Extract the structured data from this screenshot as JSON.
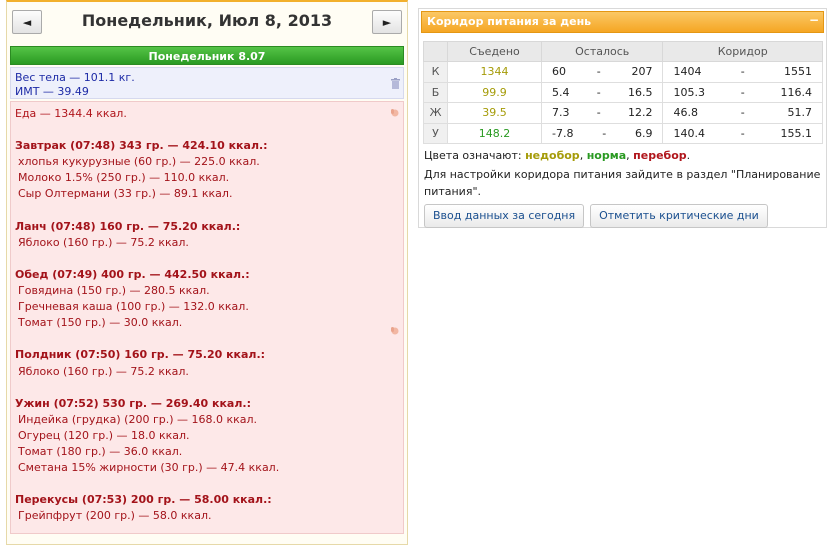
{
  "header": {
    "prev_label": "◄",
    "next_label": "►",
    "date_title": "Понедельник, Июл 8, 2013"
  },
  "day_bar": "Понедельник 8.07",
  "body": {
    "weight": "Вес тела — 101.1 кг.",
    "bmi": "ИМТ — 39.49"
  },
  "food": {
    "total": "Еда — 1344.4 ккал.",
    "meals": [
      {
        "title": "Завтрак (07:48) 343 гр. — 424.10 ккал.:",
        "items": [
          "хлопья кукурузные (60 гр.) — 225.0 ккал.",
          "Молоко 1.5% (250 гр.) — 110.0 ккал.",
          "Сыр Олтермани (33 гр.) — 89.1 ккал."
        ]
      },
      {
        "title": "Ланч (07:48) 160 гр. — 75.20 ккал.:",
        "items": [
          "Яблоко (160 гр.) — 75.2 ккал."
        ]
      },
      {
        "title": "Обед (07:49) 400 гр. — 442.50 ккал.:",
        "items": [
          "Говядина (150 гр.) — 280.5 ккал.",
          "Гречневая каша (100 гр.) — 132.0 ккал.",
          "Томат (150 гр.) — 30.0 ккал."
        ]
      },
      {
        "title": "Полдник (07:50) 160 гр. — 75.20 ккал.:",
        "items": [
          "Яблоко (160 гр.) — 75.2 ккал."
        ]
      },
      {
        "title": "Ужин (07:52) 530 гр. — 269.40 ккал.:",
        "items": [
          "Индейка (грудка) (200 гр.) — 168.0 ккал.",
          "Огурец (120 гр.) — 18.0 ккал.",
          "Томат (180 гр.) — 36.0 ккал.",
          "Сметана 15% жирности (30 гр.) — 47.4 ккал."
        ]
      },
      {
        "title": "Перекусы (07:53) 200 гр. — 58.00 ккал.:",
        "items": [
          "Грейпфрут (200 гр.) — 58.0 ккал."
        ]
      }
    ]
  },
  "corridor": {
    "title": "Коридор питания за день",
    "collapse_label": "−",
    "headers": {
      "eaten": "Съедено",
      "left": "Осталось",
      "corridor": "Коридор"
    },
    "dash": "-",
    "rows": [
      {
        "letter": "К",
        "eaten": "1344",
        "status": "under",
        "left_min": "60",
        "left_max": "207",
        "corr_min": "1404",
        "corr_max": "1551"
      },
      {
        "letter": "Б",
        "eaten": "99.9",
        "status": "under",
        "left_min": "5.4",
        "left_max": "16.5",
        "corr_min": "105.3",
        "corr_max": "116.4"
      },
      {
        "letter": "Ж",
        "eaten": "39.5",
        "status": "under",
        "left_min": "7.3",
        "left_max": "12.2",
        "corr_min": "46.8",
        "corr_max": "51.7"
      },
      {
        "letter": "У",
        "eaten": "148.2",
        "status": "norm",
        "left_min": "-7.8",
        "left_max": "6.9",
        "corr_min": "140.4",
        "corr_max": "155.1"
      }
    ],
    "legend": {
      "prefix": "Цвета означают: ",
      "under": "недобор",
      "sep1": ", ",
      "norm": "норма",
      "sep2": ", ",
      "over": "перебор",
      "end": "."
    },
    "hint": "Для настройки коридора питания зайдите в раздел \"Планирование питания\".",
    "btn_enter": "Ввод данных за сегодня",
    "btn_critical": "Отметить критические дни"
  },
  "colors": {
    "under": "#a59b08",
    "norm": "#2a9a22",
    "over": "#b0151b",
    "accent": "#f5a623",
    "day_bar": "#2a9a22"
  }
}
